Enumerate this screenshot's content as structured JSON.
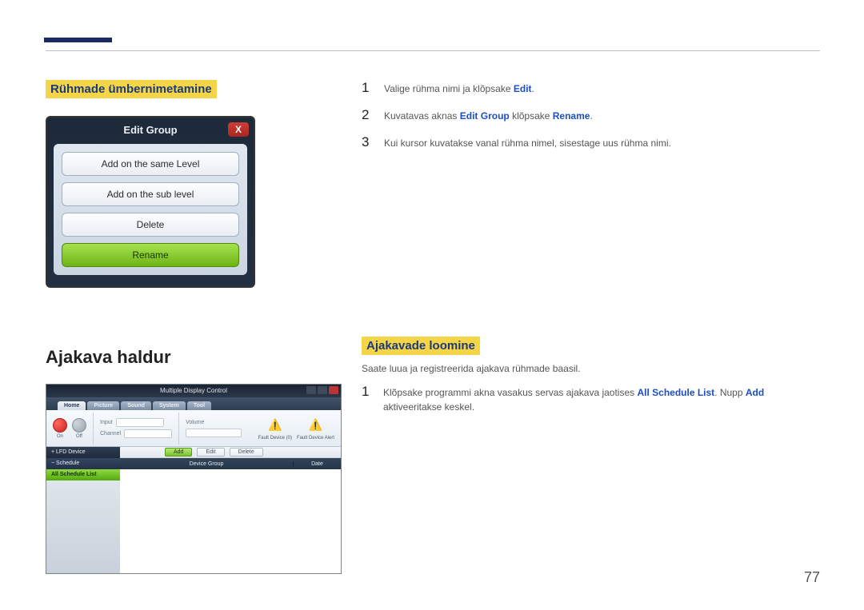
{
  "section1": {
    "title": "Rühmade ümbernimetamine",
    "dialog": {
      "title": "Edit Group",
      "buttons": {
        "sameLevel": "Add on the same Level",
        "subLevel": "Add on the sub level",
        "delete": "Delete",
        "rename": "Rename"
      },
      "closeGlyph": "X"
    }
  },
  "steps1": {
    "s1_pre": "Valige rühma nimi ja klõpsake ",
    "s1_kw": "Edit",
    "s1_post": ".",
    "s2_pre": "Kuvatavas aknas ",
    "s2_kw1": "Edit Group",
    "s2_mid": " klõpsake ",
    "s2_kw2": "Rename",
    "s2_post": ".",
    "s3": "Kui kursor kuvatakse vanal rühma nimel, sisestage uus rühma nimi."
  },
  "section2": {
    "title": "Ajakava haldur",
    "window": {
      "title": "Multiple Display Control",
      "tabs": {
        "home": "Home",
        "picture": "Picture",
        "sound": "Sound",
        "system": "System",
        "tool": "Tool"
      },
      "ribbon": {
        "on": "On",
        "off": "Off",
        "input": "Input",
        "channel": "Channel",
        "volume": "Volume",
        "faultDevice": "Fault Device (0)",
        "faultAlert": "Fault Device Alert"
      },
      "side": {
        "lfd": "+ LFD Device",
        "schedule": "− Schedule",
        "allList": "All Schedule List"
      },
      "toolbar": {
        "add": "Add",
        "edit": "Edit",
        "delete": "Delete"
      },
      "gridHeader": {
        "group": "Device Group",
        "date": "Date"
      }
    }
  },
  "section3": {
    "title": "Ajakavade loomine",
    "intro": "Saate luua ja registreerida ajakava rühmade baasil.",
    "s1_pre": "Klõpsake programmi akna vasakus servas ajakava jaotises ",
    "s1_kw1": "All Schedule List",
    "s1_mid": ". Nupp ",
    "s1_kw2": "Add",
    "s1_post": " aktiveeritakse keskel."
  },
  "nums": {
    "n1": "1",
    "n2": "2",
    "n3": "3"
  },
  "pageNumber": "77"
}
